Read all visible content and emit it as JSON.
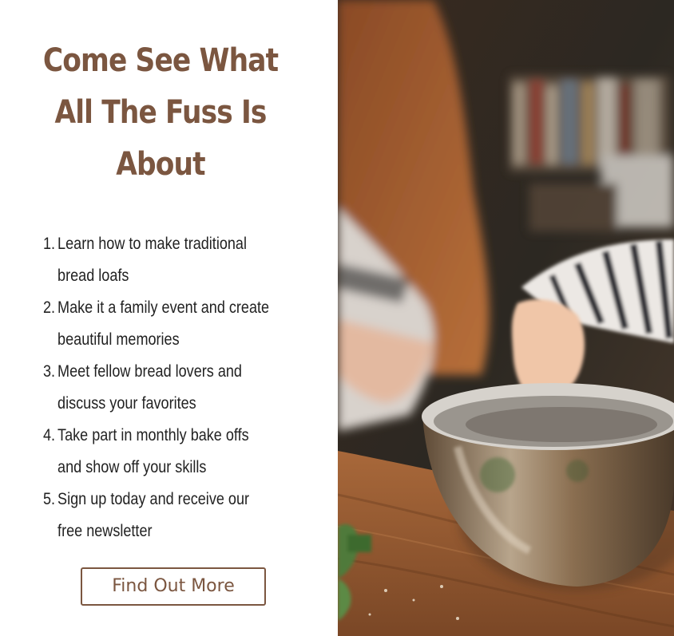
{
  "heading": "Come See What All The Fuss Is About",
  "benefits": [
    {
      "num": "1.",
      "text": "Learn how to make traditional bread loafs"
    },
    {
      "num": "2.",
      "text": "Make it a family event and create beautiful memories"
    },
    {
      "num": "3.",
      "text": "Meet fellow bread lovers and discuss your favorites"
    },
    {
      "num": "4.",
      "text": "Take part in monthly bake offs and show off your skills"
    },
    {
      "num": "5.",
      "text": "Sign up today and receive our free newsletter"
    }
  ],
  "cta_label": "Find Out More",
  "colors": {
    "accent_brown": "#7b5640",
    "text_dark": "#222222",
    "background": "#ffffff"
  },
  "image": {
    "subject": "children mixing ingredients in a metal bowl on a wooden table"
  }
}
